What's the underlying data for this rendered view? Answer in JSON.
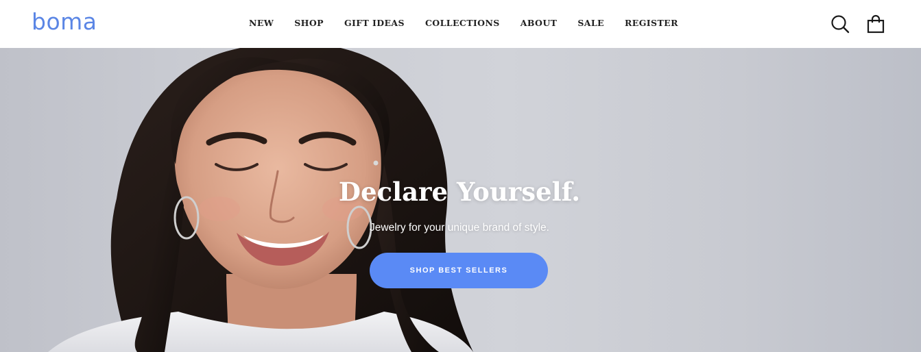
{
  "brand": {
    "logo_text": "boma"
  },
  "nav": {
    "items": [
      {
        "label": "NEW"
      },
      {
        "label": "SHOP"
      },
      {
        "label": "GIFT IDEAS"
      },
      {
        "label": "COLLECTIONS"
      },
      {
        "label": "ABOUT"
      },
      {
        "label": "SALE"
      },
      {
        "label": "REGISTER"
      }
    ]
  },
  "header_icons": {
    "search": "search-icon",
    "cart": "shopping-bag-icon"
  },
  "hero": {
    "title": "Declare Yourself.",
    "subtitle": "Jewelry for your unique brand of style.",
    "cta_label": "SHOP BEST SELLERS"
  },
  "colors": {
    "brand_blue": "#5b86e5",
    "cta_blue": "#5a8af5",
    "nav_text": "#222222",
    "hero_text": "#ffffff"
  }
}
